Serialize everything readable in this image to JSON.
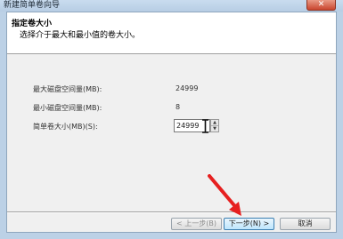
{
  "window": {
    "title": "新建简单卷向导",
    "close_glyph": "✕"
  },
  "header": {
    "title": "指定卷大小",
    "subtitle": "选择介于最大和最小值的卷大小。"
  },
  "fields": {
    "max_label": "最大磁盘空间量(MB):",
    "max_value": "24999",
    "min_label": "最小磁盘空间量(MB):",
    "min_value": "8",
    "size_label": "简单卷大小(MB)(S):",
    "size_value": "24999"
  },
  "buttons": {
    "back_label": "< 上一步(B)",
    "next_label": "下一步(N) >",
    "cancel_label": "取消"
  },
  "icons": {
    "spin_up": "▲",
    "spin_down": "▼",
    "cursor": "ibeam-cursor-icon",
    "annotation": "red-arrow-annotation"
  },
  "colors": {
    "annotation_arrow": "#e62020",
    "default_button_border": "#3c7fb1",
    "header_bg": "#ffffff",
    "frame": "#bcd1e6"
  }
}
